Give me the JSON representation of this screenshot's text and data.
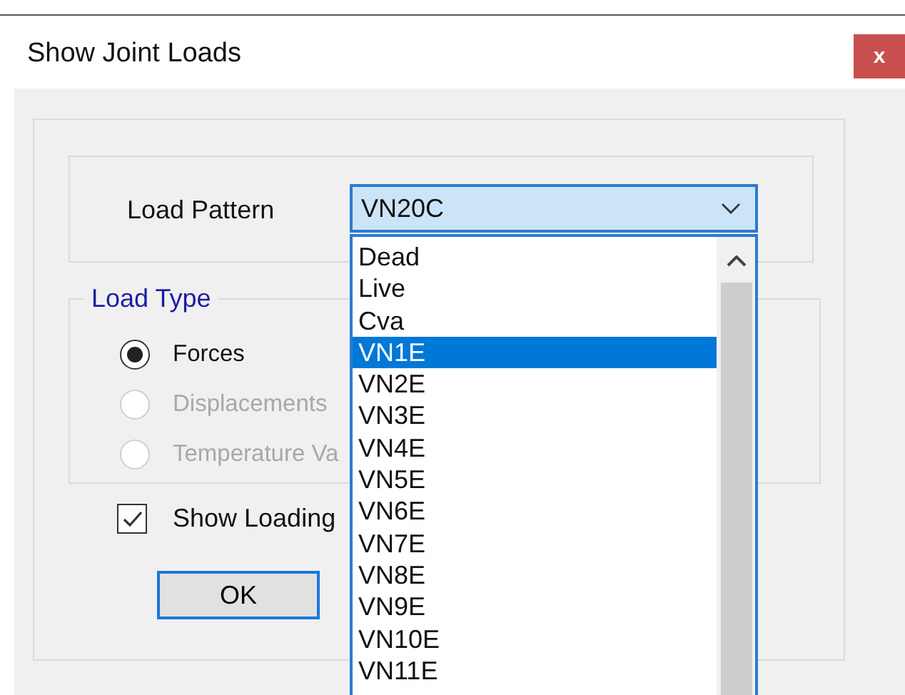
{
  "window": {
    "title": "Show Joint Loads",
    "close_label": "x"
  },
  "load_pattern": {
    "label": "Load Pattern",
    "value": "VN20C",
    "expanded": true,
    "options": [
      {
        "label": "Dead",
        "selected": false
      },
      {
        "label": "Live",
        "selected": false
      },
      {
        "label": "Cva",
        "selected": false
      },
      {
        "label": "VN1E",
        "selected": true
      },
      {
        "label": "VN2E",
        "selected": false
      },
      {
        "label": "VN3E",
        "selected": false
      },
      {
        "label": "VN4E",
        "selected": false
      },
      {
        "label": "VN5E",
        "selected": false
      },
      {
        "label": "VN6E",
        "selected": false
      },
      {
        "label": "VN7E",
        "selected": false
      },
      {
        "label": "VN8E",
        "selected": false
      },
      {
        "label": "VN9E",
        "selected": false
      },
      {
        "label": "VN10E",
        "selected": false
      },
      {
        "label": "VN11E",
        "selected": false
      }
    ]
  },
  "load_type": {
    "title": "Load Type",
    "options": [
      {
        "label": "Forces",
        "selected": true,
        "disabled": false
      },
      {
        "label": "Displacements",
        "selected": false,
        "disabled": true
      },
      {
        "label": "Temperature Va",
        "selected": false,
        "disabled": true
      }
    ]
  },
  "show_loading": {
    "label": "Show Loading",
    "checked": true
  },
  "buttons": [
    "OK"
  ]
}
